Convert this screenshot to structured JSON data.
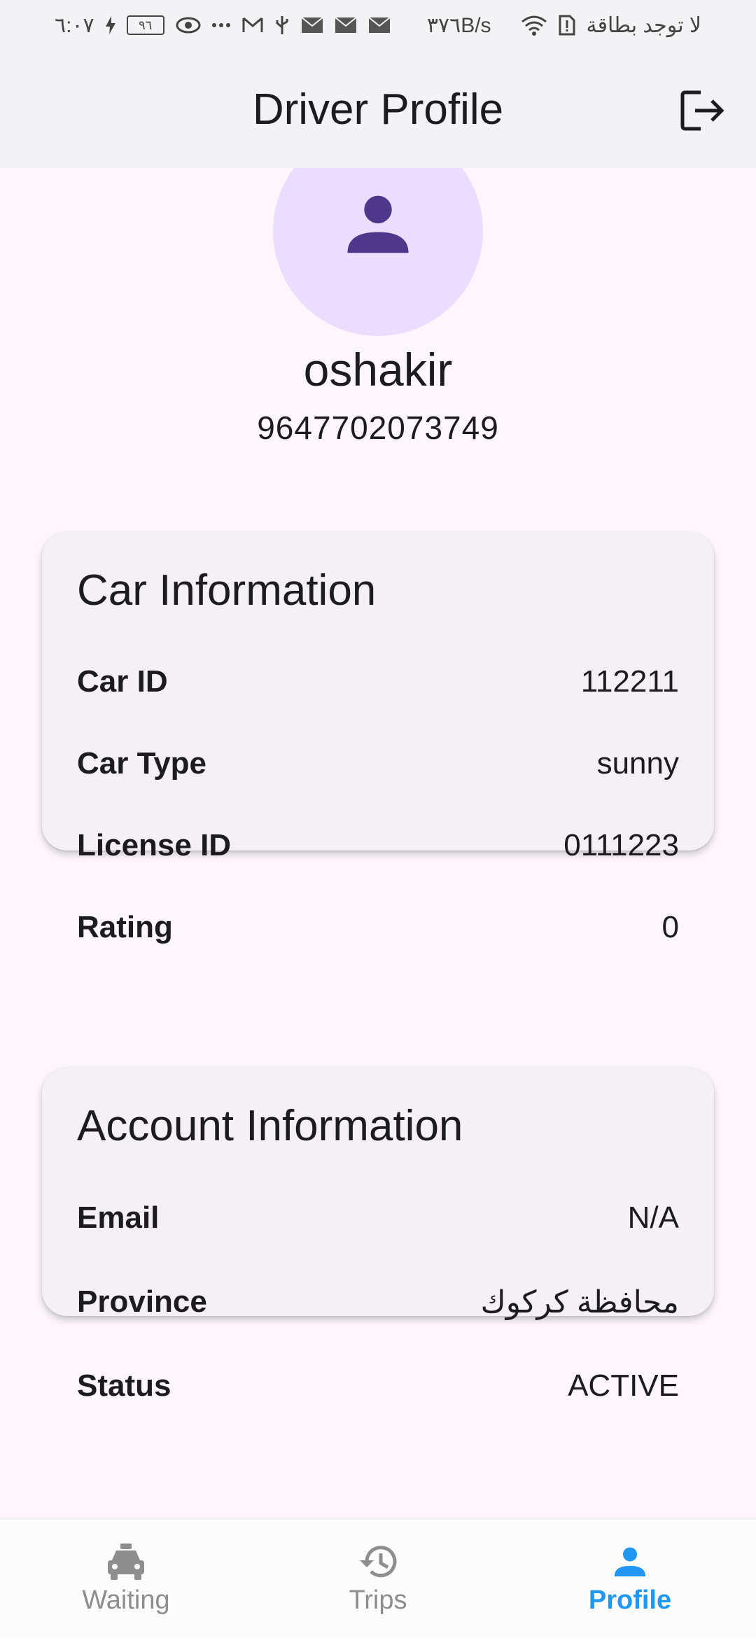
{
  "status_bar": {
    "time": "٦:٠٧",
    "battery": "٩٦",
    "network_speed": "٣٧٦B/s",
    "carrier": "لا توجد بطاقة"
  },
  "app_bar": {
    "title": "Driver Profile",
    "logout_icon": "logout-icon"
  },
  "profile": {
    "avatar_icon": "person-icon",
    "name": "oshakir",
    "phone": "9647702073749"
  },
  "car_info": {
    "title": "Car Information",
    "rows": [
      {
        "label": "Car ID",
        "value": "112211"
      },
      {
        "label": "Car Type",
        "value": "sunny"
      },
      {
        "label": "License ID",
        "value": "0111223"
      },
      {
        "label": "Rating",
        "value": "0"
      }
    ]
  },
  "account_info": {
    "title": "Account Information",
    "rows": [
      {
        "label": "Email",
        "value": "N/A"
      },
      {
        "label": "Province",
        "value": "محافظة كركوك"
      },
      {
        "label": "Status",
        "value": "ACTIVE"
      }
    ]
  },
  "bottom_nav": {
    "items": [
      {
        "label": "Waiting",
        "icon": "taxi-icon",
        "active": false
      },
      {
        "label": "Trips",
        "icon": "history-icon",
        "active": false
      },
      {
        "label": "Profile",
        "icon": "person-icon",
        "active": true
      }
    ]
  },
  "colors": {
    "accent": "#2196f3",
    "avatar_bg": "#eaddff",
    "avatar_icon": "#4f378b",
    "card_bg": "#f4f0f6",
    "page_bg": "#fdf7fd"
  }
}
